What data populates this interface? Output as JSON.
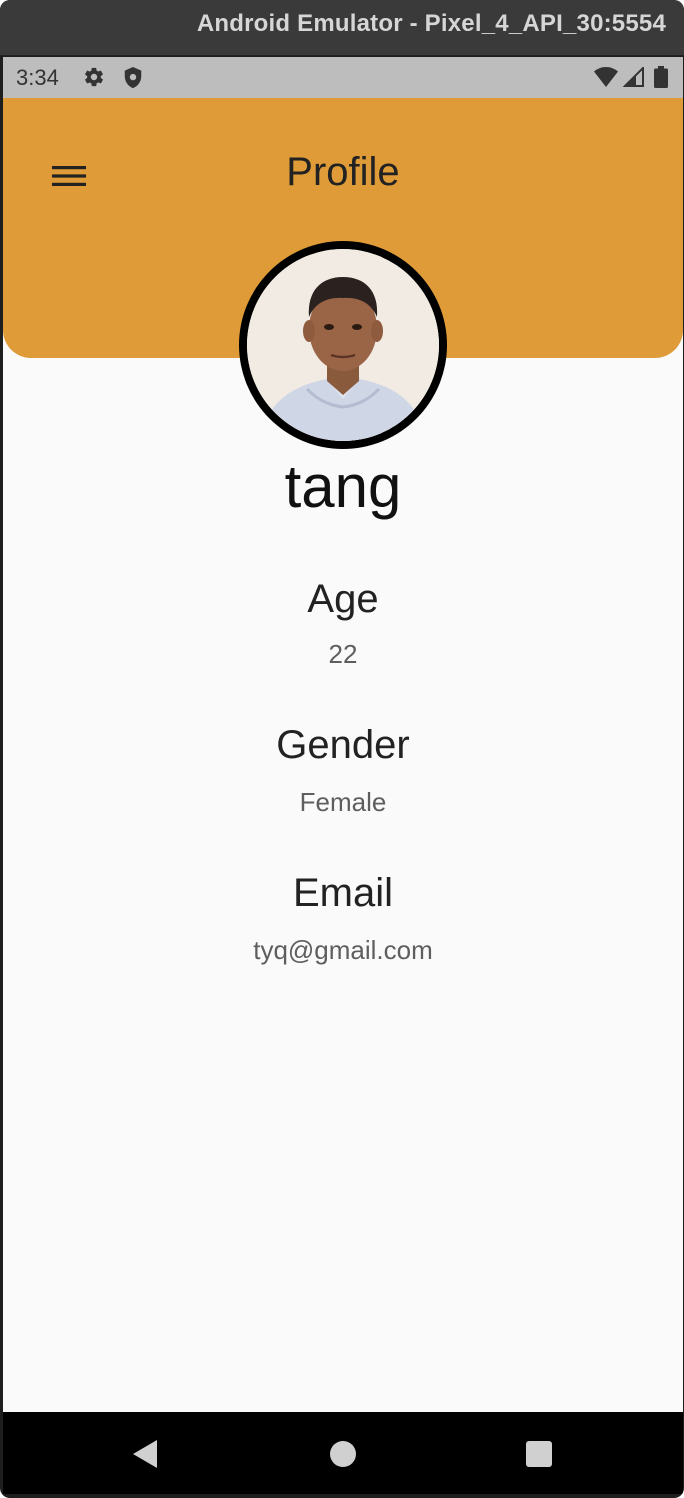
{
  "window": {
    "title": "Android Emulator - Pixel_4_API_30:5554"
  },
  "status_bar": {
    "time": "3:34",
    "icons_left": [
      "gear-icon",
      "shield-icon"
    ],
    "icons_right": [
      "wifi-icon",
      "signal-icon",
      "battery-icon"
    ]
  },
  "app_bar": {
    "title": "Profile",
    "menu_icon": "hamburger-menu-icon",
    "color": "#de9b37"
  },
  "profile": {
    "name": "tang",
    "fields": [
      {
        "label": "Age",
        "value": "22"
      },
      {
        "label": "Gender",
        "value": "Female"
      },
      {
        "label": "Email",
        "value": "tyq@gmail.com"
      }
    ]
  },
  "nav_bar": {
    "icons": [
      "back-icon",
      "home-icon",
      "recents-icon"
    ]
  }
}
